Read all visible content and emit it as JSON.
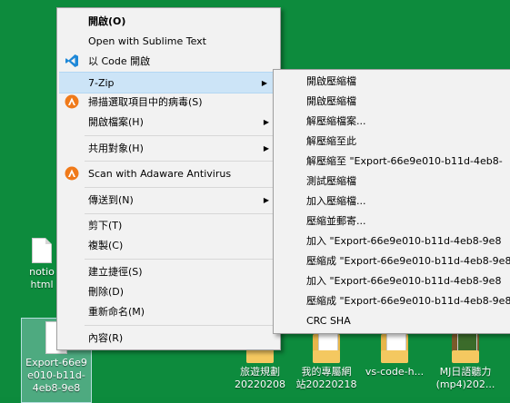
{
  "colors": {
    "desktop_bg": "#0d8b3d",
    "menu_bg": "#f2f2f2",
    "highlight": "#cce4f7"
  },
  "desktop_icons": [
    {
      "label": "notio\nhtml",
      "icon": "html-file-icon"
    },
    {
      "label": "Export-66e9\ne010-b11d-\n4eb8-9e8",
      "icon": "document-icon"
    },
    {
      "label": "旅遊規劃\n20220208",
      "icon": "folder-icon"
    },
    {
      "label": "我的專屬網\n站20220218",
      "icon": "folder-icon"
    },
    {
      "label": "vs-code-h...",
      "icon": "folder-icon"
    },
    {
      "label": "MJ日語聽力\n(mp4)202...",
      "icon": "folder-icon"
    }
  ],
  "context_menu": {
    "items": [
      {
        "label": "開啟(O)",
        "icon": "",
        "submenu": false
      },
      {
        "label": "Open with Sublime Text",
        "icon": "",
        "submenu": false
      },
      {
        "label": "以 Code 開啟",
        "icon": "vscode-icon",
        "submenu": false
      },
      {
        "label": "7-Zip",
        "icon": "",
        "submenu": true,
        "highlight": true
      },
      {
        "label": "掃描選取項目中的病毒(S)",
        "icon": "adaware-icon",
        "submenu": false
      },
      {
        "label": "開啟檔案(H)",
        "icon": "",
        "submenu": true
      },
      {
        "label": "共用對象(H)",
        "icon": "",
        "submenu": true
      },
      {
        "label": "Scan with Adaware Antivirus",
        "icon": "adaware-icon",
        "submenu": false
      },
      {
        "label": "傳送到(N)",
        "icon": "",
        "submenu": true
      },
      {
        "label": "剪下(T)",
        "icon": "",
        "submenu": false
      },
      {
        "label": "複製(C)",
        "icon": "",
        "submenu": false
      },
      {
        "label": "建立捷徑(S)",
        "icon": "",
        "submenu": false
      },
      {
        "label": "刪除(D)",
        "icon": "",
        "submenu": false
      },
      {
        "label": "重新命名(M)",
        "icon": "",
        "submenu": false
      },
      {
        "label": "內容(R)",
        "icon": "",
        "submenu": false
      }
    ]
  },
  "zip_submenu": {
    "items": [
      "開啟壓縮檔",
      "開啟壓縮檔",
      "解壓縮檔案...",
      "解壓縮至此",
      "解壓縮至 \"Export-66e9e010-b11d-4eb8-",
      "測試壓縮檔",
      "加入壓縮檔...",
      "壓縮並郵寄...",
      "加入 \"Export-66e9e010-b11d-4eb8-9e8",
      "壓縮成 \"Export-66e9e010-b11d-4eb8-9e8",
      "加入 \"Export-66e9e010-b11d-4eb8-9e8",
      "壓縮成 \"Export-66e9e010-b11d-4eb8-9e8",
      "CRC SHA"
    ]
  }
}
